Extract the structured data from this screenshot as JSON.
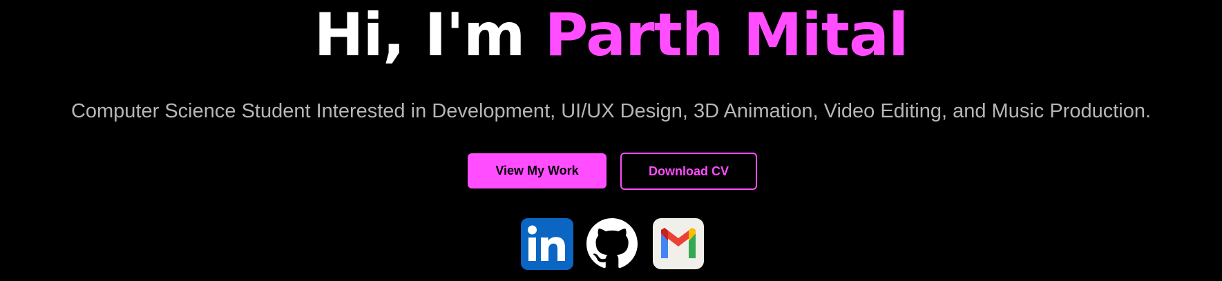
{
  "hero": {
    "greeting": "Hi, I'm ",
    "name": "Parth Mital",
    "tagline": "Computer Science Student Interested in Development, UI/UX Design, 3D Animation, Video Editing, and Music Production.",
    "primary_button_label": "View My Work",
    "secondary_button_label": "Download CV"
  },
  "social_links": [
    {
      "icon": "linkedin-icon"
    },
    {
      "icon": "github-icon"
    },
    {
      "icon": "gmail-icon"
    }
  ],
  "colors": {
    "background": "#000000",
    "accent": "#ff4dff",
    "title": "#ffffff",
    "tagline": "#b6b6b6",
    "linkedin_blue": "#0a66c2"
  }
}
